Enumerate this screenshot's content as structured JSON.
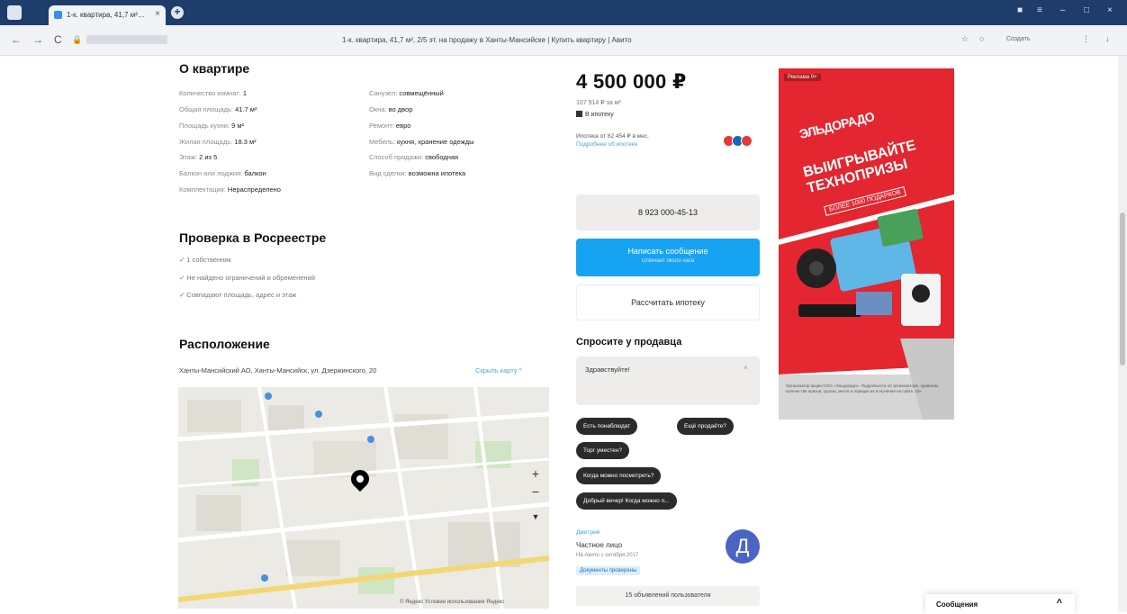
{
  "browser": {
    "tab_title": "1-к. квартира, 41,7 м²…",
    "tab_close": "×",
    "new_tab": "+",
    "page_title": "1-к. квартира, 41,7 м², 2/5 эт. на продажу в Ханты-Мансийске | Купить квартиру | Авито",
    "nav": {
      "back": "←",
      "forward": "→",
      "reload": "C"
    },
    "right_label": "Создать"
  },
  "about": {
    "title": "О квартире",
    "left": [
      {
        "k": "Количество комнат: ",
        "v": "1"
      },
      {
        "k": "Общая площадь: ",
        "v": "41.7 м²"
      },
      {
        "k": "Площадь кухни: ",
        "v": "9 м²"
      },
      {
        "k": "Жилая площадь: ",
        "v": "18.3 м²"
      },
      {
        "k": "Этаж: ",
        "v": "2 из 5"
      },
      {
        "k": "Балкон или лоджия: ",
        "v": "балкон"
      },
      {
        "k": "Санузел: ",
        "v": "совмещённый"
      }
    ],
    "right": [
      {
        "k": "Санузел: ",
        "v": "совмещённый"
      },
      {
        "k": "Окна: ",
        "v": "во двор"
      },
      {
        "k": "Ремонт: ",
        "v": "евро"
      },
      {
        "k": "Мебель: ",
        "v": "кухня, хранение одежды"
      },
      {
        "k": "Способ продажи: ",
        "v": "свободная"
      },
      {
        "k": "Вид сделки: ",
        "v": "возможна ипотека"
      }
    ],
    "extra": {
      "k": "Комплектация: ",
      "v": "Нераспределено"
    }
  },
  "registry": {
    "title": "Проверка в Росреестре",
    "checks": [
      "1 собственник",
      "Не найдено ограничений и обременений",
      "Совпадают площадь, адрес и этаж"
    ]
  },
  "location": {
    "title": "Расположение",
    "address": "Ханты-Мансийский АО, Ханты-Мансийск, ул. Дзержинского, 20",
    "show_map": "Скрыть карту ^",
    "zoom_in": "+",
    "zoom_out": "−",
    "map_footer": "© Яндекс  Условия использования  Яндекс"
  },
  "offer": {
    "price": "4 500 000 ₽",
    "price_per_m2": "107 914 ₽ за м²",
    "mortgage": "В ипотеку",
    "mortgage_rate": "Ипотека от 62 454 ₽ в мес.",
    "mortgage_link": "Подробнее об ипотеке",
    "phone_button": "8 923 000-45-13",
    "write_button": "Написать сообщение",
    "write_sub": "Отвечает около часа",
    "calc_button": "Рассчитать ипотеку",
    "bank_colors": [
      "#e53935",
      "#1565c0",
      "#e53935"
    ]
  },
  "ask": {
    "title": "Спросите у продавца",
    "input_value": "Здравствуйте!",
    "clear": "×",
    "chips": [
      "Есть понаблюдат",
      "Ещё продаёте?",
      "Торг уместен?",
      "Когда можно посмотреть?",
      "Добрый вечер! Когда можно п..."
    ]
  },
  "seller": {
    "name": "Дмитрий",
    "type": "Частное лицо",
    "since": "На Авито с октября 2017",
    "badge": "Документы проверены",
    "avatar_letter": "Д",
    "ads": "15 объявлений пользователя"
  },
  "ad": {
    "tag": "Реклама  0+",
    "brand": "ЭЛЬДОРАДО",
    "headline_1": "ВЫИГРЫВАЙТЕ",
    "headline_2": "ТЕХНОПРИЗЫ",
    "sub": "БОЛЕЕ 1000 ПОДАРКОВ",
    "legal": "Организатор акции ООО «Эльдорадо». Подробности об организаторе, правилах, количестве призов, сроках, месте и порядке их получения на сайте. 18+",
    "red": "#e3262f"
  },
  "messages": {
    "label": "Сообщения",
    "chevron": "^"
  }
}
